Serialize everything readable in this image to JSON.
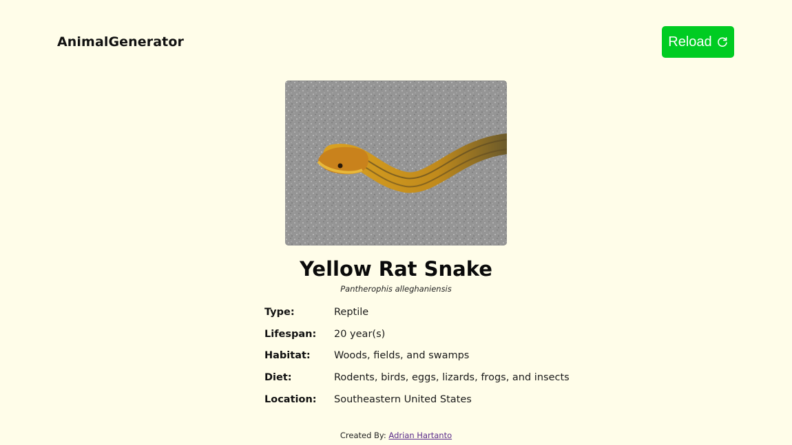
{
  "header": {
    "brand": "AnimalGenerator",
    "reload_label": "Reload"
  },
  "animal": {
    "image_alt": "Yellow Rat Snake",
    "name": "Yellow Rat Snake",
    "latin_name": "Pantherophis alleghaniensis",
    "facts": [
      {
        "label": "Type:",
        "value": "Reptile"
      },
      {
        "label": "Lifespan:",
        "value": "20 year(s)"
      },
      {
        "label": "Habitat:",
        "value": "Woods, fields, and swamps"
      },
      {
        "label": "Diet:",
        "value": "Rodents, birds, eggs, lizards, frogs, and insects"
      },
      {
        "label": "Location:",
        "value": "Southeastern United States"
      }
    ]
  },
  "footer": {
    "prefix": "Created By: ",
    "author": "Adrian Hartanto"
  },
  "colors": {
    "background": "#fffde9",
    "reload_button": "#00cc22"
  },
  "icons": {
    "reload": "refresh-icon"
  }
}
